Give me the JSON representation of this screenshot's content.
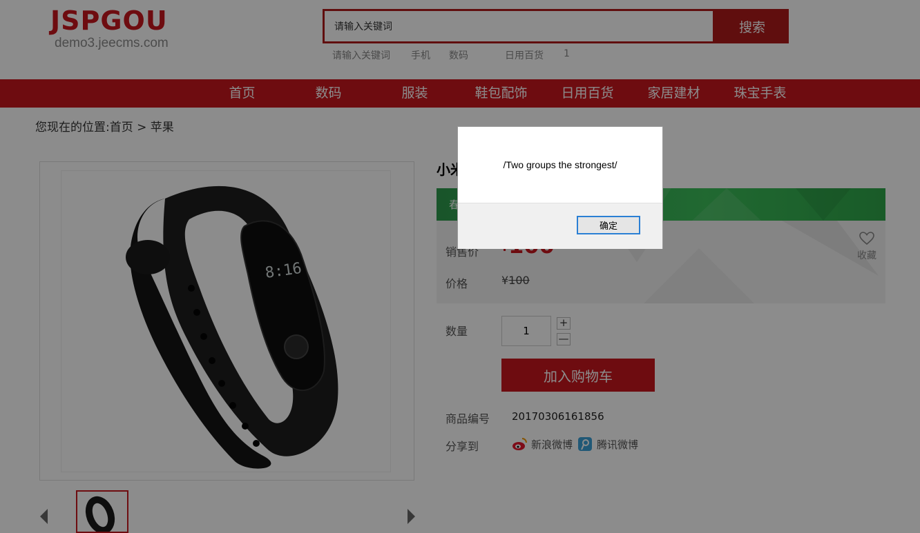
{
  "header": {
    "logo_main": "JSPGOU",
    "logo_sub": "demo3.jeecms.com",
    "search": {
      "value": "请输入关键词",
      "button_label": "搜索"
    },
    "hot_words": [
      "请输入关键词",
      "手机",
      "数码",
      "日用百货",
      "1"
    ]
  },
  "nav": {
    "items": [
      "首页",
      "数码",
      "服装",
      "鞋包配饰",
      "日用百货",
      "家居建材",
      "珠宝手表"
    ]
  },
  "breadcrumb": {
    "prefix": "您现在的位置:",
    "home": "首页",
    "separator": " > ",
    "current": "苹果"
  },
  "product": {
    "title_visible": "小米",
    "promo_text": "春",
    "sale_price_label": "销售价",
    "sale_price_currency": "¥",
    "sale_price": "100",
    "price_label": "价格",
    "price_currency": "¥",
    "price": "100",
    "favorite_label": "收藏",
    "quantity_label": "数量",
    "quantity": "1",
    "plus": "+",
    "minus": "—",
    "add_to_cart": "加入购物车",
    "sku_label": "商品编号",
    "sku": "20170306161856",
    "share_label": "分享到",
    "share_weibo": "新浪微博",
    "share_tencent": "腾讯微博",
    "band_display": "8:16"
  },
  "dialog": {
    "message": "/Two groups the strongest/",
    "ok_label": "确定"
  },
  "colors": {
    "brand_red": "#c9171e",
    "promo_green": "#3cbf5a",
    "overlay": "rgba(0,0,0,0.45)",
    "focus_blue": "#2a7fd4"
  }
}
